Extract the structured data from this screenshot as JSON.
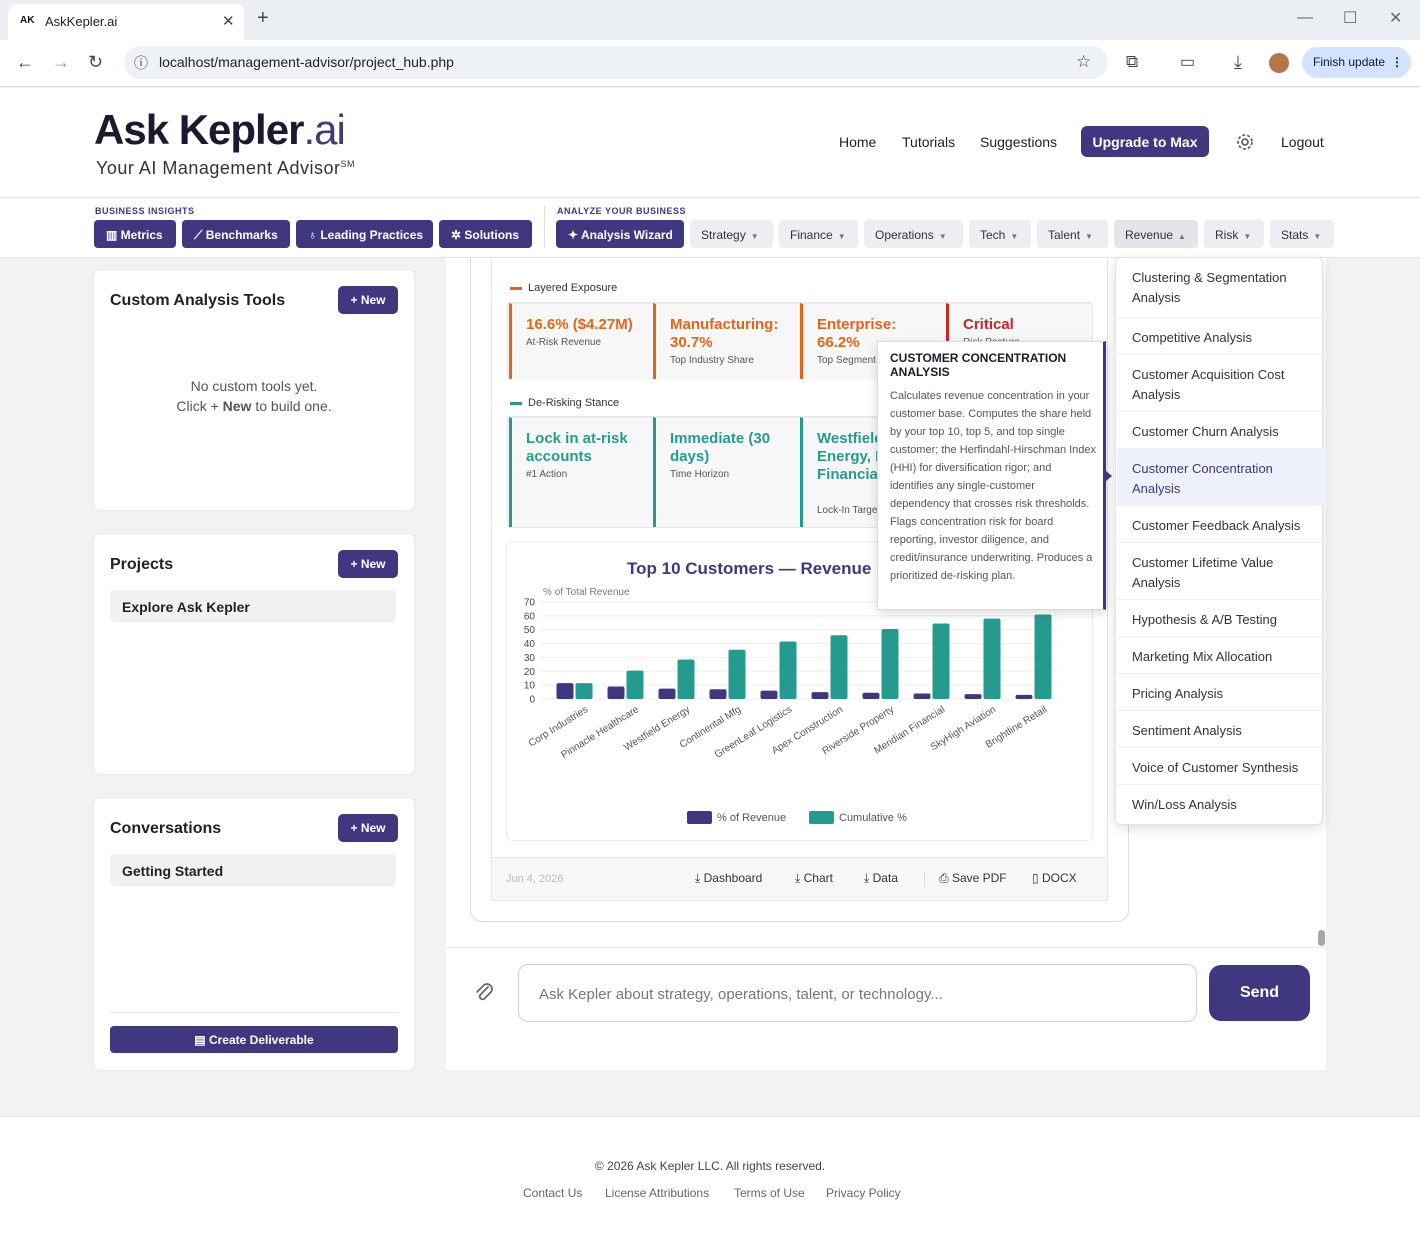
{
  "browser": {
    "tab_icon": "AK",
    "tab_title": "AskKepler.ai",
    "url": "localhost/management-advisor/project_hub.php",
    "finish_update": "Finish update"
  },
  "header": {
    "logo_main": "Ask Kepler",
    "logo_suffix": ".ai",
    "tagline": "Your AI Management Advisor",
    "tagline_mark": "SM",
    "nav": [
      "Home",
      "Tutorials",
      "Suggestions"
    ],
    "upgrade": "Upgrade to Max",
    "logout": "Logout"
  },
  "toolbar": {
    "insights_label": "BUSINESS INSIGHTS",
    "insights": [
      "Metrics",
      "Benchmarks",
      "Leading Practices",
      "Solutions"
    ],
    "analyze_label": "ANALYZE YOUR BUSINESS",
    "wizard": "Analysis Wizard",
    "menus": [
      "Strategy",
      "Finance",
      "Operations",
      "Tech",
      "Talent",
      "Revenue",
      "Risk",
      "Stats"
    ]
  },
  "sidebar": {
    "tools_title": "Custom Analysis Tools",
    "tools_new": "+ New",
    "tools_empty_1": "No custom tools yet.",
    "tools_empty_2a": "Click + ",
    "tools_empty_2b": "New",
    "tools_empty_2c": " to build one.",
    "projects_title": "Projects",
    "projects_new": "+ New",
    "project_item": "Explore Ask Kepler",
    "conv_title": "Conversations",
    "conv_new": "+ New",
    "conv_item": "Getting Started",
    "deliverable": "Create Deliverable"
  },
  "report": {
    "exposure_label": "Layered Exposure",
    "exposure": [
      {
        "value": "16.6% ($4.27M)",
        "caption": "At-Risk Revenue"
      },
      {
        "value": "Manufacturing: 30.7%",
        "caption": "Top Industry Share"
      },
      {
        "value": "Enterprise: 66.2%",
        "caption": "Top Segment"
      },
      {
        "value": "Critical",
        "caption": "Risk Posture"
      }
    ],
    "derisk_label": "De-Risking Stance",
    "derisk": [
      {
        "value": "Lock in at-risk accounts",
        "caption": "#1 Action"
      },
      {
        "value": "Immediate (30 days)",
        "caption": "Time Horizon"
      },
      {
        "value": "Westfield Energy, Meridian Financial",
        "caption": "Lock-In Targets"
      }
    ],
    "date": "Jun 4, 2026",
    "downloads": [
      "Dashboard",
      "Chart",
      "Data",
      "Save PDF",
      "DOCX"
    ]
  },
  "chart_data": {
    "type": "bar",
    "title": "Top 10 Customers — Revenue",
    "ylabel": "% of Total Revenue",
    "ylim": [
      0,
      70
    ],
    "yticks": [
      0,
      10,
      20,
      30,
      40,
      50,
      60,
      70
    ],
    "categories": [
      "Corp Industries",
      "Pinnacle Healthcare",
      "Westfield Energy",
      "Continental Mfg",
      "GreenLeaf Logistics",
      "Apex Construction",
      "Riverside Property",
      "Meridian Financial",
      "SkyHigh Aviation",
      "Brightline Retail"
    ],
    "series": [
      {
        "name": "% of Revenue",
        "color": "#3f3880",
        "values": [
          11.5,
          9,
          7.5,
          7,
          6,
          5,
          4.5,
          4,
          3.5,
          3
        ]
      },
      {
        "name": "Cumulative %",
        "color": "#259b8f",
        "values": [
          11.5,
          20.5,
          28.5,
          35.5,
          41.5,
          46,
          50.5,
          54.5,
          58,
          61
        ]
      }
    ]
  },
  "tooltip": {
    "title": "CUSTOMER CONCENTRATION ANALYSIS",
    "body": "Calculates revenue concentration in your customer base. Computes the share held by your top 10, top 5, and top single customer; the Herfindahl-Hirschman Index (HHI) for diversification rigor; and identifies any single-customer dependency that crosses risk thresholds. Flags concentration risk for board reporting, investor diligence, and credit/insurance underwriting. Produces a prioritized de-risking plan."
  },
  "revenue_menu": [
    "Clustering & Segmentation Analysis",
    "Competitive Analysis",
    "Customer Acquisition Cost Analysis",
    "Customer Churn Analysis",
    "Customer Concentration Analysis",
    "Customer Feedback Analysis",
    "Customer Lifetime Value Analysis",
    "Hypothesis & A/B Testing",
    "Marketing Mix Allocation",
    "Pricing Analysis",
    "Sentiment Analysis",
    "Voice of Customer Synthesis",
    "Win/Loss Analysis"
  ],
  "chat": {
    "placeholder": "Ask Kepler about strategy, operations, talent, or technology...",
    "send": "Send"
  },
  "footer": {
    "copyright": "© 2026 Ask Kepler LLC. All rights reserved.",
    "links": [
      "Contact Us",
      "License Attributions",
      "Terms of Use",
      "Privacy Policy"
    ]
  },
  "colors": {
    "brand": "#3f3880",
    "teal": "#259b8f",
    "orange": "#e0661a",
    "critical": "#c62828"
  }
}
